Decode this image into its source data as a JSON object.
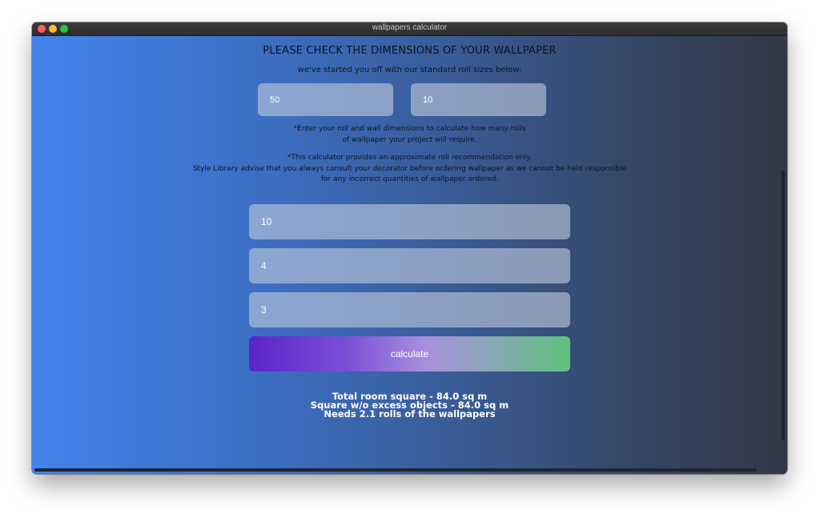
{
  "window": {
    "title": "wallpapers calculator"
  },
  "header": {
    "title": "PLEASE CHECK THE DIMENSIONS OF YOUR WALLPAPER",
    "subtitle": "we've started you off with our standard roll sizes below:"
  },
  "roll": {
    "width_value": "50",
    "length_value": "10"
  },
  "notes": {
    "dimensions_line1": "*Enter your roll and wall dimensions to calculate how many rolls",
    "dimensions_line2": "of wallpaper your project will require.",
    "disclaimer_line1": "*This calculator provides an approximate roll recommendation only.",
    "disclaimer_line2": "Style Library advise that you always consult your decorator before ordering wallpaper as we cannot be held responsible",
    "disclaimer_line3": "for any incorrect quantities of wallpaper ordered."
  },
  "wall": {
    "length_value": "10",
    "width_value": "4",
    "height_value": "3"
  },
  "actions": {
    "calculate_label": "calculate"
  },
  "results": {
    "total_room": "Total room square - 84.0 sq m",
    "without_objects": "Square w/o excess objects - 84.0 sq m",
    "rolls_needed": "Needs 2.1 rolls of the wallpapers"
  },
  "colors": {
    "traffic_close": "#ff5f57",
    "traffic_minimize": "#febc2e",
    "traffic_maximize": "#28c840",
    "background_start": "#4283ec",
    "background_end": "#323846",
    "button_start": "#5b24c9",
    "button_end": "#5ec27d"
  }
}
